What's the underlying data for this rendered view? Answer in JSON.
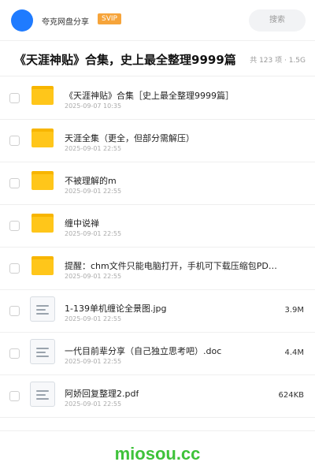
{
  "header": {
    "brand": "夸克网盘分享",
    "badge": "SVIP",
    "search_placeholder": "搜索",
    "avatar_color": "#1f7bff",
    "badge_color": "#f6a43a"
  },
  "share": {
    "title": "《天涯神贴》合集，史上最全整理9999篇",
    "meta": "共 123 项 · 1.5G"
  },
  "files": [
    {
      "type": "folder",
      "name": "《天涯神贴》合集［史上最全整理9999篇］",
      "date": "2025-09-07 10:35",
      "size": ""
    },
    {
      "type": "folder",
      "name": "天涯全集（更全，但部分需解压）",
      "date": "2025-09-01 22:55",
      "size": ""
    },
    {
      "type": "folder",
      "name": "不被理解的m",
      "date": "2025-09-01 22:55",
      "size": ""
    },
    {
      "type": "folder",
      "name": "缠中说禅",
      "date": "2025-09-01 22:55",
      "size": ""
    },
    {
      "type": "folder",
      "name": "提醒：chm文件只能电脑打开，手机可下载压缩包PD…",
      "date": "2025-09-01 22:55",
      "size": ""
    },
    {
      "type": "file",
      "name": "1-139单机缠论全景图.jpg",
      "date": "2025-09-01 22:55",
      "size": "3.9M"
    },
    {
      "type": "file",
      "name": "一代目前辈分享（自己独立思考吧）.doc",
      "date": "2025-09-01 22:55",
      "size": "4.4M"
    },
    {
      "type": "file",
      "name": "阿娇回复整理2.pdf",
      "date": "2025-09-01 22:55",
      "size": "624KB"
    }
  ],
  "watermark": "miosou.cc",
  "colors": {
    "folder": "#ffc61a",
    "watermark": "#3ec23a"
  }
}
